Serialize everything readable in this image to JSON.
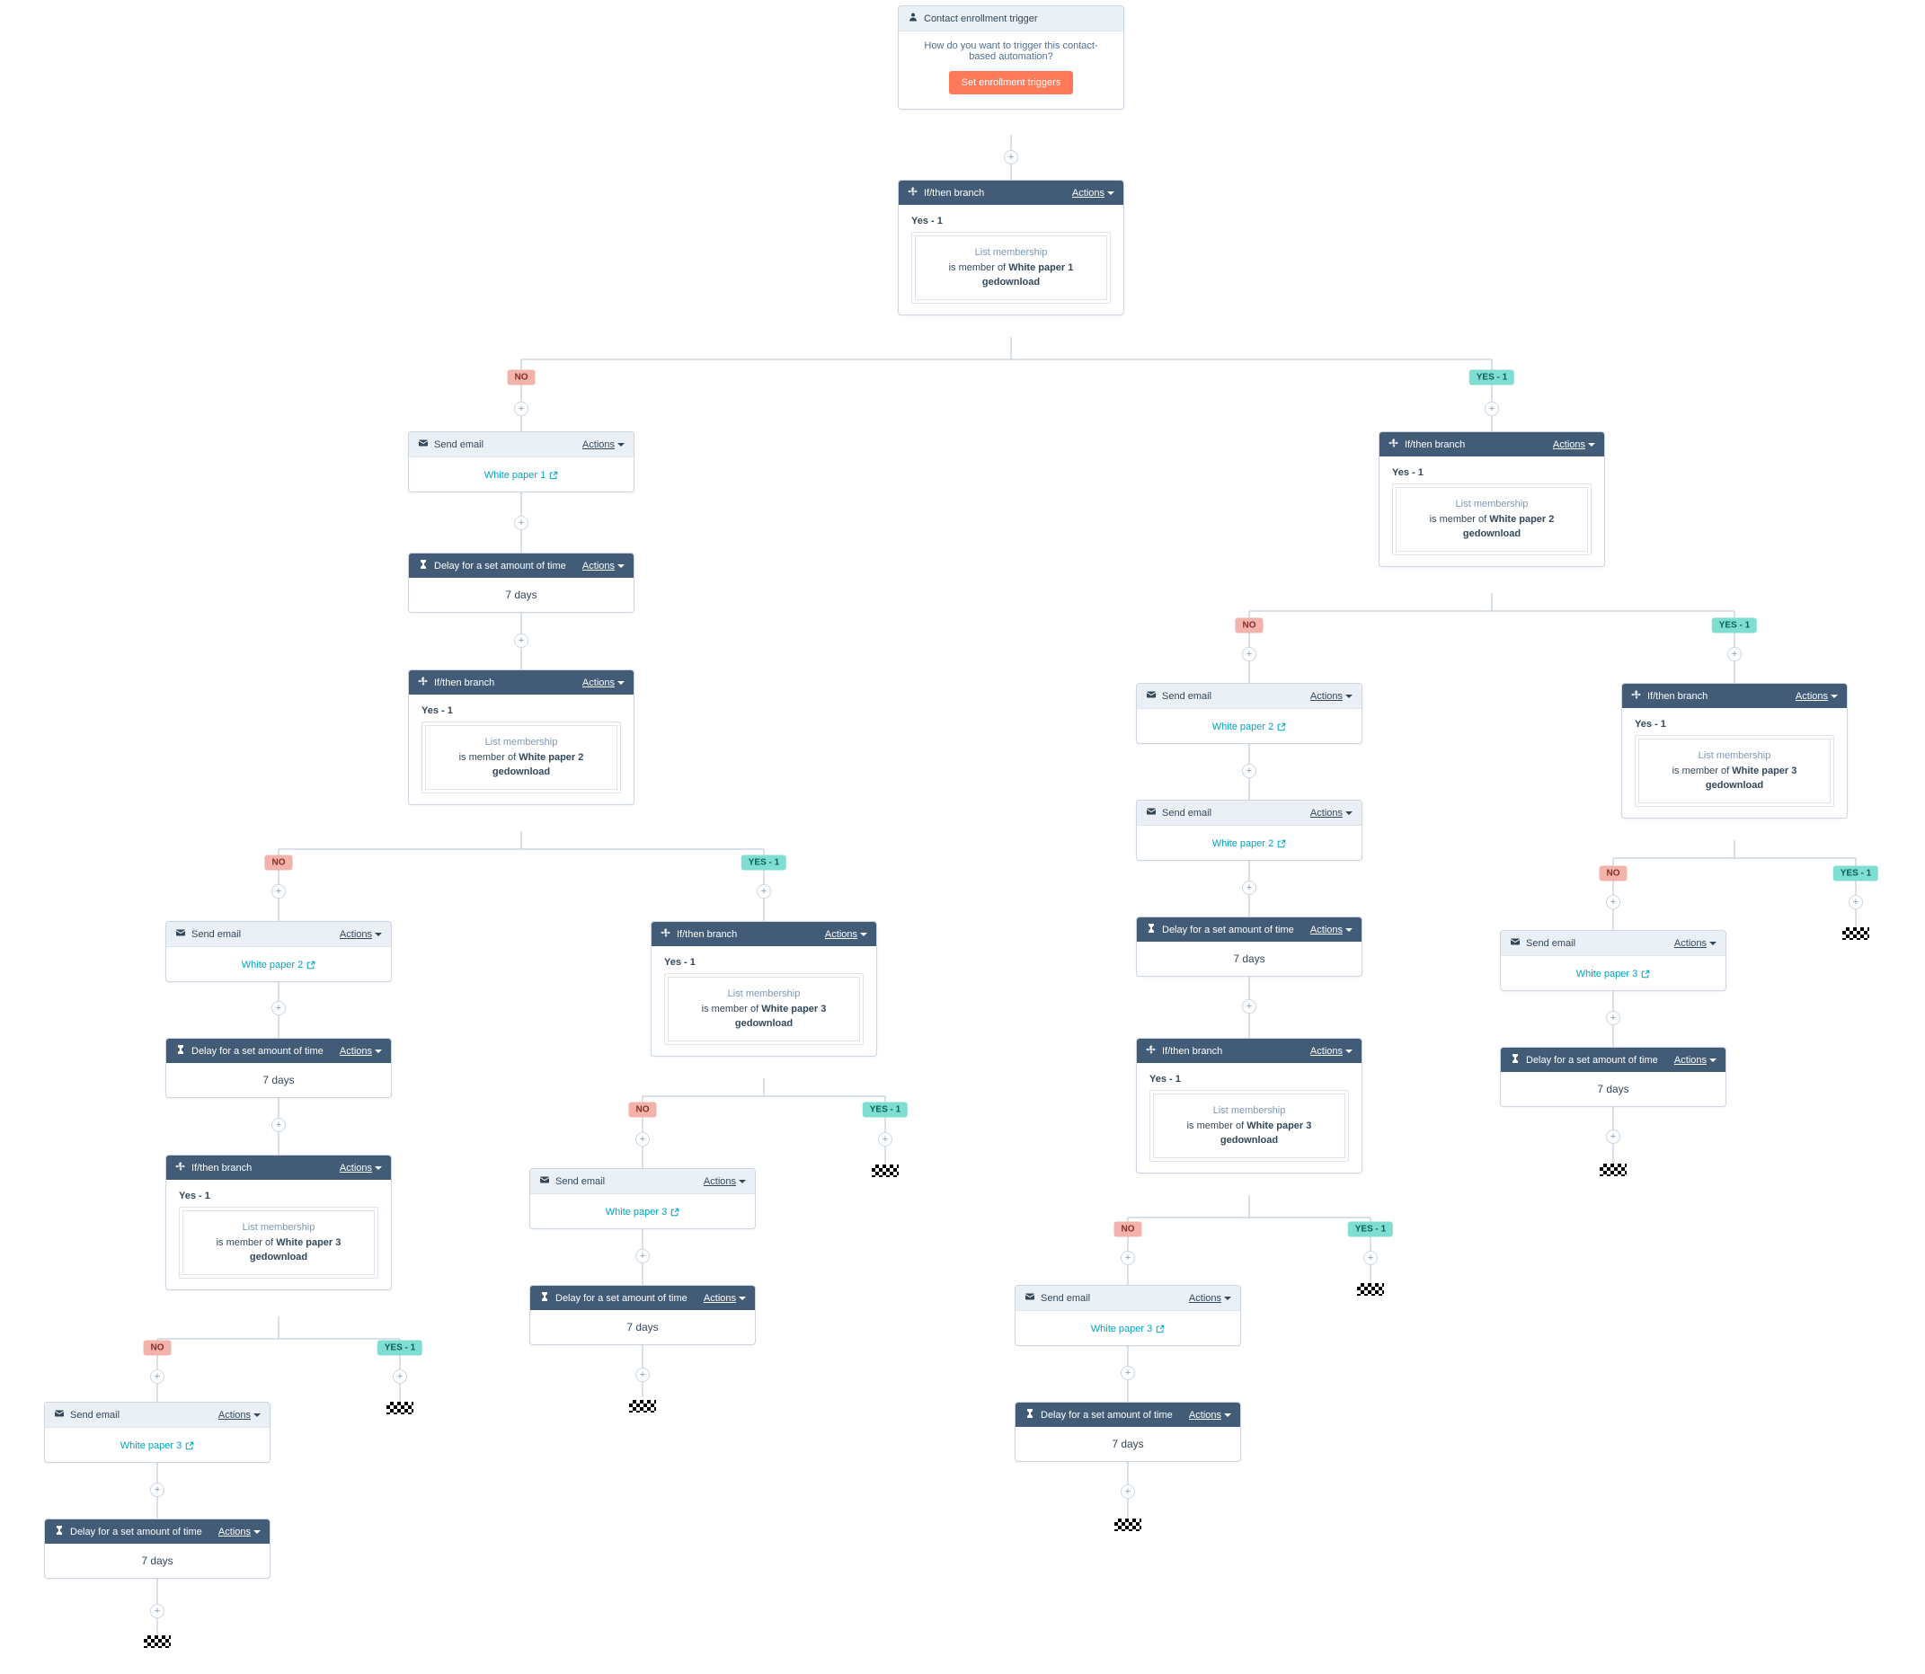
{
  "common": {
    "actions": "Actions",
    "yes1": "Yes - 1",
    "listMembership": "List membership",
    "isMemberOf": "is member of",
    "gedownload": "gedownload",
    "sevenDays": "7 days"
  },
  "titles": {
    "trigger": "Contact enrollment trigger",
    "ifThen": "If/then branch",
    "sendEmail": "Send email",
    "delay": "Delay for a set amount of time"
  },
  "lists": {
    "wp1": "White paper 1",
    "wp2": "White paper 2",
    "wp3": "White paper 3"
  },
  "trigger": {
    "question": "How do you want to trigger this contact-based automation?",
    "button": "Set enrollment triggers"
  },
  "pills": {
    "no": "NO",
    "yes": "YES - 1"
  }
}
